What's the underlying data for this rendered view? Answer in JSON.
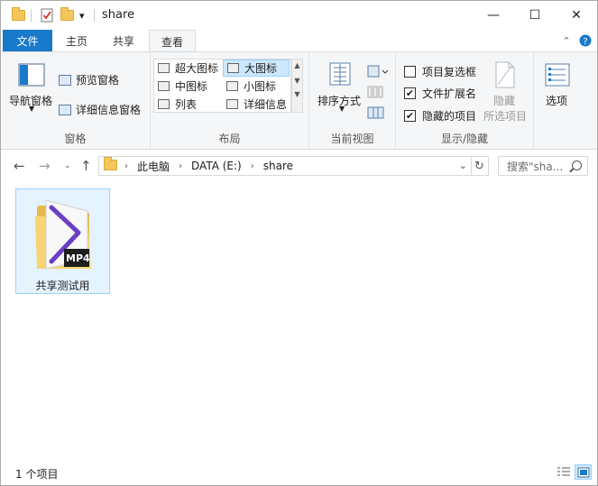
{
  "window": {
    "title": "share",
    "quick_access_arrow": "▾",
    "controls": {
      "minimize": "—",
      "maximize": "☐",
      "close": "✕"
    }
  },
  "ribbon_tabs": [
    {
      "label": "文件"
    },
    {
      "label": "主页"
    },
    {
      "label": "共享"
    },
    {
      "label": "查看"
    }
  ],
  "ribbon": {
    "panes": {
      "label": "窗格",
      "nav_pane": "导航窗格",
      "preview_pane": "预览窗格",
      "details_pane": "详细信息窗格"
    },
    "layout": {
      "label": "布局",
      "items": [
        "超大图标",
        "大图标",
        "中图标",
        "小图标",
        "列表",
        "详细信息"
      ],
      "selected": "大图标"
    },
    "current_view": {
      "label": "当前视图",
      "sort_by": "排序方式"
    },
    "show_hide": {
      "label": "显示/隐藏",
      "item_checkboxes": "项目复选框",
      "file_extensions": "文件扩展名",
      "hidden_items": "隐藏的项目",
      "hide_selected_line1": "隐藏",
      "hide_selected_line2": "所选项目",
      "checks": {
        "item_checkboxes": "",
        "file_extensions": "✔",
        "hidden_items": "✔"
      }
    },
    "options": "选项"
  },
  "address_bar": {
    "segments": [
      "此电脑",
      "DATA (E:)",
      "share"
    ],
    "search_placeholder": "搜索\"sha..."
  },
  "files": [
    {
      "name": "共享测试用",
      "badge": "MP4",
      "icon": "folder-video-icon"
    }
  ],
  "status": {
    "item_count": "1 个项目"
  },
  "colors": {
    "accent": "#1979ca",
    "selection_bg": "#e5f3ff",
    "selection_border": "#99d1ff",
    "folder": "#f4c75a",
    "video_purple": "#6b3fc4"
  }
}
